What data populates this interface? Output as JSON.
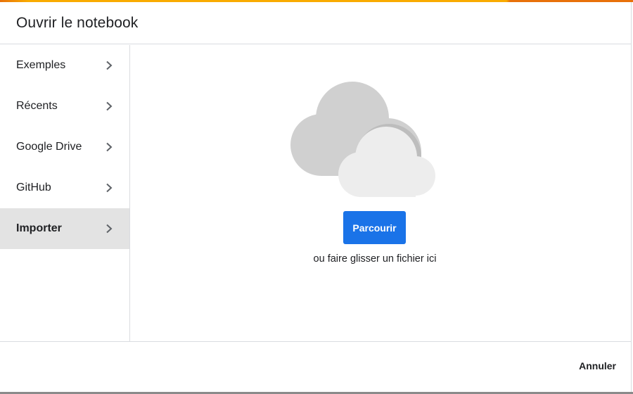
{
  "dialog": {
    "title": "Ouvrir le notebook"
  },
  "sidebar": {
    "items": [
      {
        "label": "Exemples",
        "active": false
      },
      {
        "label": "Récents",
        "active": false
      },
      {
        "label": "Google Drive",
        "active": false
      },
      {
        "label": "GitHub",
        "active": false
      },
      {
        "label": "Importer",
        "active": true
      }
    ]
  },
  "upload": {
    "icon": "cloud-icon",
    "browse_label": "Parcourir",
    "drop_hint": "ou faire glisser un fichier ici"
  },
  "footer": {
    "cancel_label": "Annuler"
  },
  "colors": {
    "accent_orange": "#e8710a",
    "accent_yellow": "#f9ab00",
    "primary_button": "#1a73e8",
    "active_item_bg": "#e3e3e3"
  }
}
